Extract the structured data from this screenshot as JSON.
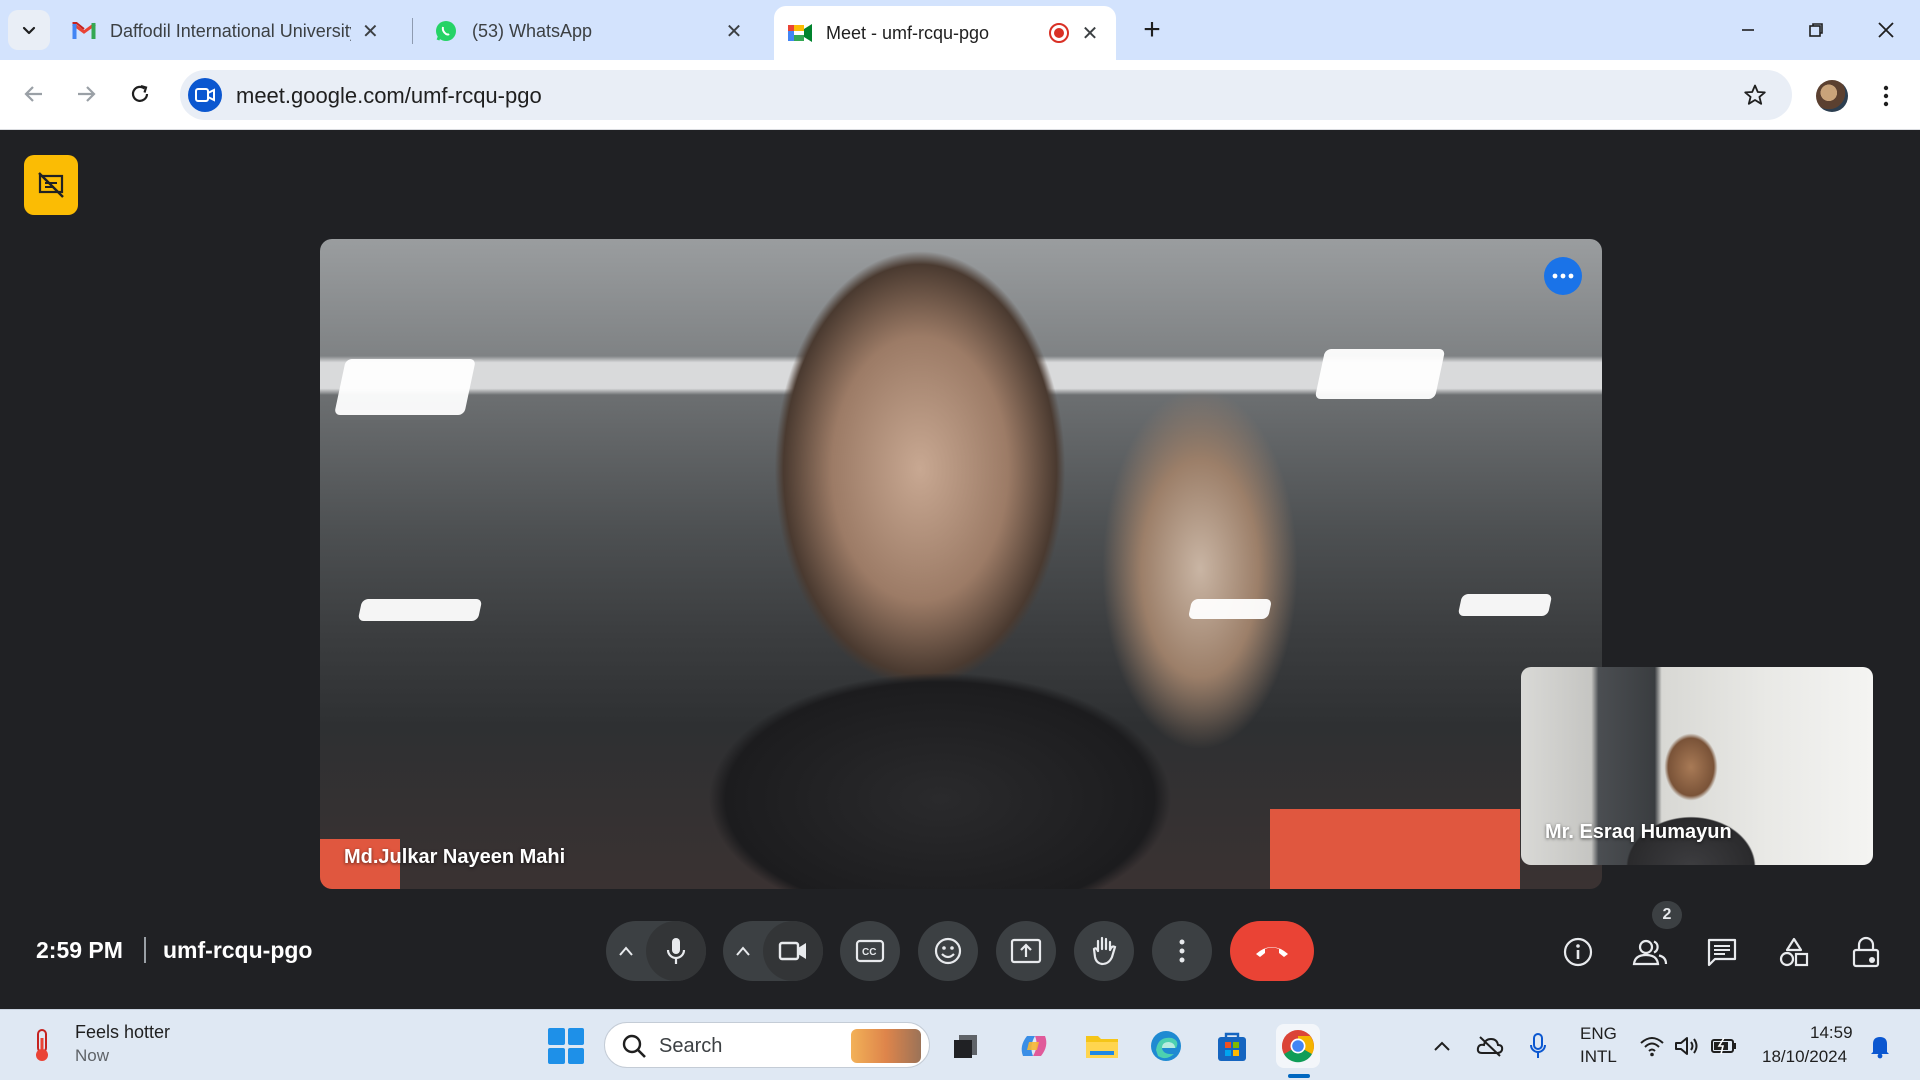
{
  "browser": {
    "tabs": [
      {
        "title": "Daffodil International University",
        "favicon": "gmail-icon",
        "active": false
      },
      {
        "title": "(53) WhatsApp",
        "favicon": "whatsapp-icon",
        "active": false
      },
      {
        "title": "Meet - umf-rcqu-pgo",
        "favicon": "google-meet-icon",
        "active": true,
        "recording": true
      }
    ],
    "url": "meet.google.com/umf-rcqu-pgo"
  },
  "meet": {
    "main_participant": "Md.Julkar Nayeen Mahi",
    "self_participant": "Mr. Esraq Humayun",
    "time": "2:59 PM",
    "meeting_code": "umf-rcqu-pgo",
    "people_count": "2",
    "hangup_color": "#ea4335",
    "badge_color": "#fbbc04"
  },
  "taskbar": {
    "weather_title": "Feels hotter",
    "weather_sub": "Now",
    "search_placeholder": "Search",
    "language_line1": "ENG",
    "language_line2": "INTL",
    "clock_time": "14:59",
    "clock_date": "18/10/2024"
  }
}
